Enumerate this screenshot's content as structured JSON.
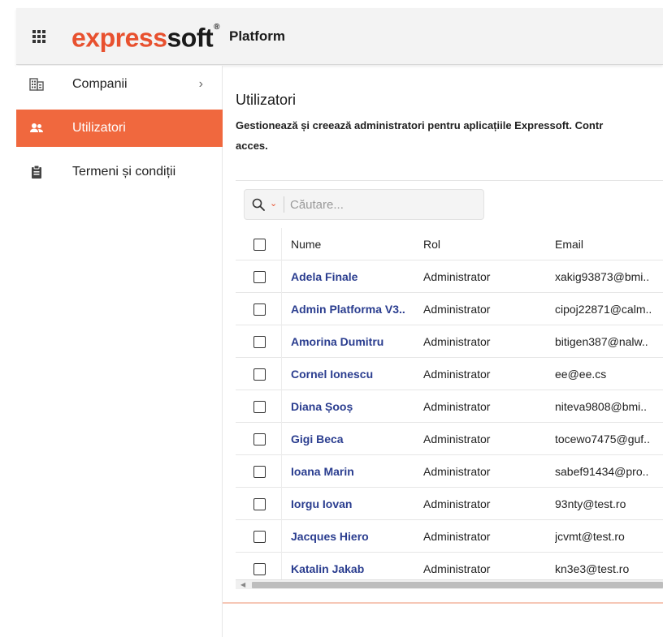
{
  "header": {
    "apps_icon": "grid-apps-icon",
    "logo_express": "express",
    "logo_soft": "soft",
    "logo_reg": "®",
    "platform_label": "Platform"
  },
  "sidebar": {
    "items": [
      {
        "label": "Companii",
        "icon": "building-icon",
        "has_chevron": true,
        "chevron": "›"
      },
      {
        "label": "Utilizatori",
        "icon": "users-icon",
        "active": true
      },
      {
        "label": "Termeni și condiții",
        "icon": "clipboard-icon"
      }
    ]
  },
  "main": {
    "title": "Utilizatori",
    "description_line1": "Gestionează și creează administratori pentru aplicațiile Expressoft. Contr",
    "description_line2": "acces."
  },
  "search": {
    "placeholder": "Căutare...",
    "icon": "search-icon"
  },
  "table": {
    "columns": [
      "Nume",
      "Rol",
      "Email"
    ],
    "rows": [
      {
        "name": "Adela Finale",
        "role": "Administrator",
        "email": "xakig93873@bmi.."
      },
      {
        "name": "Admin Platforma V3..",
        "role": "Administrator",
        "email": "cipoj22871@calm.."
      },
      {
        "name": "Amorina Dumitru",
        "role": "Administrator",
        "email": "bitigen387@nalw.."
      },
      {
        "name": "Cornel Ionescu",
        "role": "Administrator",
        "email": "ee@ee.cs"
      },
      {
        "name": "Diana Șooș",
        "role": "Administrator",
        "email": "niteva9808@bmi.."
      },
      {
        "name": "Gigi Beca",
        "role": "Administrator",
        "email": "tocewo7475@guf.."
      },
      {
        "name": "Ioana Marin",
        "role": "Administrator",
        "email": "sabef91434@pro.."
      },
      {
        "name": "Iorgu Iovan",
        "role": "Administrator",
        "email": "93nty@test.ro"
      },
      {
        "name": "Jacques Hiero",
        "role": "Administrator",
        "email": "jcvmt@test.ro"
      },
      {
        "name": "Katalin Jakab",
        "role": "Administrator",
        "email": "kn3e3@test.ro"
      }
    ]
  },
  "colors": {
    "brand_orange": "#e8512f",
    "active_nav": "#f0683e",
    "link_blue": "#2a3d8f"
  }
}
